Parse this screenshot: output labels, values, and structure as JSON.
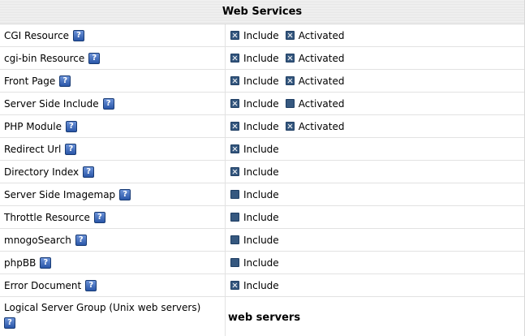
{
  "panel": {
    "title": "Web Services",
    "rows": [
      {
        "label": "CGI Resource",
        "include_label": "Include",
        "include_checked": true,
        "activated_label": "Activated",
        "activated_checked": true
      },
      {
        "label": "cgi-bin Resource",
        "include_label": "Include",
        "include_checked": true,
        "activated_label": "Activated",
        "activated_checked": true
      },
      {
        "label": "Front Page",
        "include_label": "Include",
        "include_checked": true,
        "activated_label": "Activated",
        "activated_checked": true
      },
      {
        "label": "Server Side Include",
        "include_label": "Include",
        "include_checked": true,
        "activated_label": "Activated",
        "activated_checked": false
      },
      {
        "label": "PHP Module",
        "include_label": "Include",
        "include_checked": true,
        "activated_label": "Activated",
        "activated_checked": true
      },
      {
        "label": "Redirect Url",
        "include_label": "Include",
        "include_checked": true
      },
      {
        "label": "Directory Index",
        "include_label": "Include",
        "include_checked": true
      },
      {
        "label": "Server Side Imagemap",
        "include_label": "Include",
        "include_checked": false
      },
      {
        "label": "Throttle Resource",
        "include_label": "Include",
        "include_checked": false
      },
      {
        "label": "mnogoSearch",
        "include_label": "Include",
        "include_checked": false
      },
      {
        "label": "phpBB",
        "include_label": "Include",
        "include_checked": false
      },
      {
        "label": "Error Document",
        "include_label": "Include",
        "include_checked": true
      }
    ],
    "server_group": {
      "label": "Logical Server Group (Unix web servers)",
      "value": "web servers"
    }
  },
  "icons": {
    "help": "help-icon",
    "checkbox_checked": "checked-checkbox-icon",
    "checkbox_unchecked": "unchecked-checkbox-icon"
  },
  "help_glyph": "?",
  "colors": {
    "header_bg": "#eeeeee",
    "checkbox_fill": "#36587f",
    "help_icon": "#2a57a8"
  }
}
